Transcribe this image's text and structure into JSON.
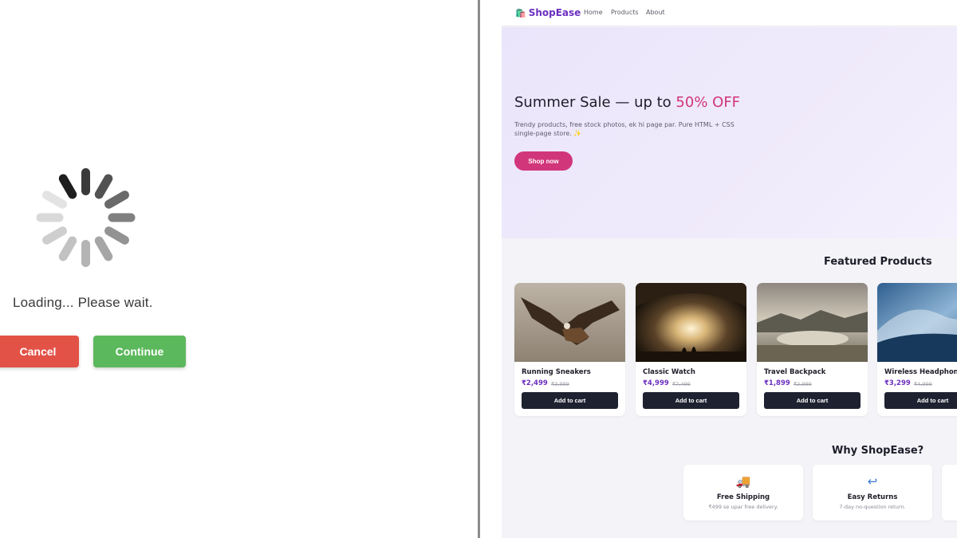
{
  "dialog": {
    "message": "Loading... Please wait.",
    "cancel_label": "Cancel",
    "continue_label": "Continue",
    "colors": {
      "cancel": "#e35247",
      "continue": "#5cb85c"
    }
  },
  "shop": {
    "brand": "ShopEase",
    "brand_icon": "shopping-bags-icon",
    "nav": [
      "Home",
      "Products",
      "About"
    ],
    "hero": {
      "title_prefix": "Summer Sale — up to ",
      "title_highlight": "50% OFF",
      "subtitle": "Trendy products, free stock photos, ek hi page par. Pure HTML + CSS single-page store. ✨",
      "cta": "Shop now"
    },
    "featured_title": "Featured Products",
    "products": [
      {
        "name": "Running Sneakers",
        "price": "₹2,499",
        "old_price": "₹3,999",
        "cta": "Add to cart",
        "image": "eagle-in-flight"
      },
      {
        "name": "Classic Watch",
        "price": "₹4,999",
        "old_price": "₹7,499",
        "cta": "Add to cart",
        "image": "glowing-cave-silhouette"
      },
      {
        "name": "Travel Backpack",
        "price": "₹1,899",
        "old_price": "₹2,999",
        "cta": "Add to cart",
        "image": "mountain-lake-landscape"
      },
      {
        "name": "Wireless Headphones",
        "price": "₹3,299",
        "old_price": "₹4,999",
        "cta": "Add to cart",
        "image": "ocean-wave"
      }
    ],
    "why_title": "Why ShopEase?",
    "features": [
      {
        "icon": "truck-icon",
        "glyph": "🚚",
        "title": "Free Shipping",
        "desc": "₹499 se upar free delivery."
      },
      {
        "icon": "return-arrow-icon",
        "glyph": "↩",
        "title": "Easy Returns",
        "desc": "7-day no-question return."
      }
    ],
    "colors": {
      "brand": "#6b2fbf",
      "accent": "#d1357a",
      "dark_button": "#1e2130"
    }
  }
}
